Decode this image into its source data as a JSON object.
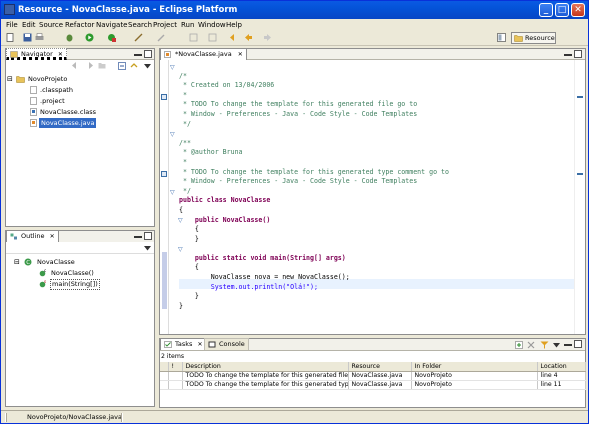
{
  "window": {
    "title": "Resource - NovaClasse.java - Eclipse Platform",
    "controls": [
      "_",
      "□",
      "✕"
    ]
  },
  "menu": [
    "File",
    "Edit",
    "Source",
    "Refactor",
    "Navigate",
    "Search",
    "Project",
    "Run",
    "Window",
    "Help"
  ],
  "perspective": {
    "label": "Resource"
  },
  "navigator": {
    "tab": "Navigator",
    "items": [
      {
        "label": "NovoProjeto",
        "icon": "project-folder-icon"
      },
      {
        "label": ".classpath",
        "icon": "file-icon"
      },
      {
        "label": ".project",
        "icon": "file-icon"
      },
      {
        "label": "NovaClasse.class",
        "icon": "class-file-icon"
      },
      {
        "label": "NovaClasse.java",
        "icon": "java-file-icon",
        "selected": true
      }
    ]
  },
  "outline": {
    "tab": "Outline",
    "items": [
      {
        "label": "NovaClasse",
        "icon": "class-icon"
      },
      {
        "label": "NovaClasse()",
        "icon": "constructor-icon"
      },
      {
        "label": "main(String[])",
        "icon": "method-icon"
      }
    ]
  },
  "editor": {
    "tab": "*NovaClasse.java",
    "lines": [
      "/*",
      " * Created on 13/04/2006",
      " *",
      " * TODO To change the template for this generated file go to",
      " * Window - Preferences - Java - Code Style - Code Templates",
      " */",
      "",
      "/**",
      " * @author Bruna",
      " *",
      " * TODO To change the template for this generated type comment go to",
      " * Window - Preferences - Java - Code Style - Code Templates",
      " */",
      "public class NovaClasse",
      "{",
      "    public NovaClasse()",
      "    {",
      "    }",
      "",
      "    public static void main(String[] args)",
      "    {",
      "        NovaClasse nova = new NovaClasse();",
      "        System.out.println(\"Olá!\");",
      "    }",
      "}"
    ]
  },
  "tasks": {
    "tab": "Tasks",
    "console_tab": "Console",
    "count": "2 items",
    "columns": [
      "!",
      "Description",
      "Resource",
      "In Folder",
      "Location"
    ],
    "rows": [
      {
        "description": "TODO To change the template for this generated file g...",
        "resource": "NovaClasse.java",
        "folder": "NovoProjeto",
        "location": "line 4"
      },
      {
        "description": "TODO To change the template for this generated type ...",
        "resource": "NovaClasse.java",
        "folder": "NovoProjeto",
        "location": "line 11"
      }
    ]
  },
  "status": {
    "text": "NovoProjeto/NovaClasse.java"
  },
  "colors": {
    "titlebar": "#0453d8",
    "selection": "#316ac5",
    "comment": "#3f7f5f",
    "keyword": "#7f0055",
    "string": "#2a00ff",
    "current_line": "#e8f2fe"
  }
}
